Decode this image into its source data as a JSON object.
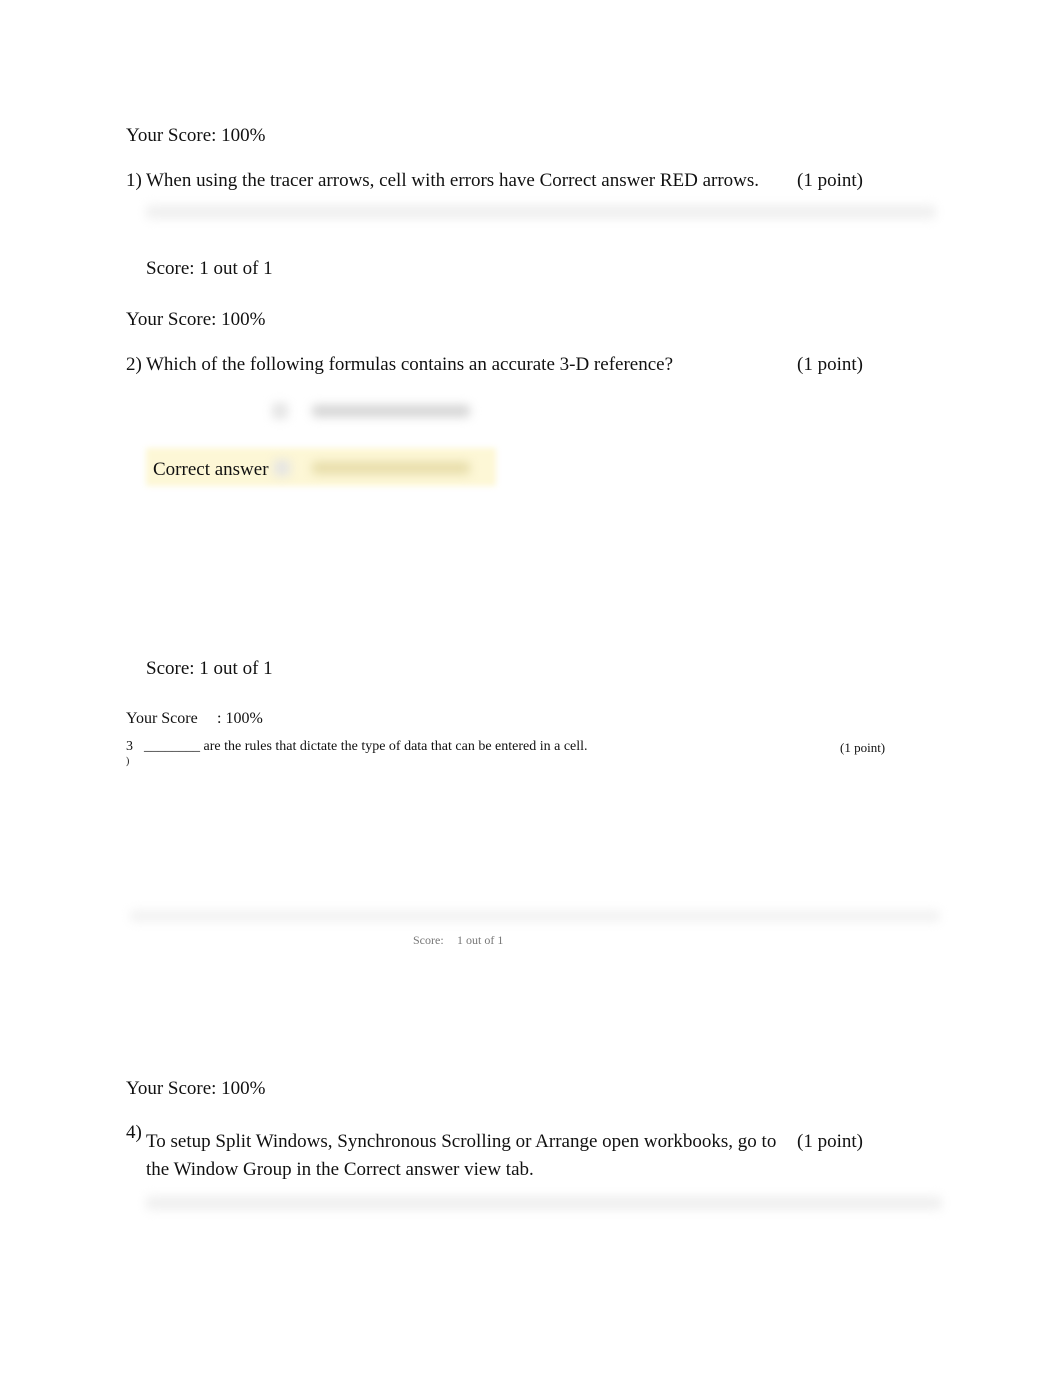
{
  "q1": {
    "score_header": "Your Score: 100%",
    "number": "1)",
    "text": "When using the tracer arrows, cell with errors have Correct answer RED arrows.",
    "points": "(1 point)",
    "score": "Score: 1 out of 1"
  },
  "q2": {
    "score_header": "Your Score: 100%",
    "number": "2)",
    "text": "Which of the following formulas contains an accurate 3-D reference?",
    "points": "(1 point)",
    "correct_label": "Correct answer",
    "score": "Score: 1 out of 1"
  },
  "q3": {
    "score_header_a": "Your Score",
    "score_header_b": ": 100%",
    "number_a": "3",
    "number_b": ")",
    "text": "________ are the rules that dictate the type of data that can be entered in a cell.",
    "points": "(1 point)",
    "score_a": "Score:",
    "score_b": "1 out of 1"
  },
  "q4": {
    "score_header": "Your Score: 100%",
    "number": "4)",
    "text_line1": "To setup Split Windows, Synchronous Scrolling or Arrange open workbooks, go to",
    "text_line2": "the Window Group in the Correct answer view tab.",
    "points": "(1 point)"
  },
  "colors": {
    "highlight": "#fdf7d6"
  }
}
